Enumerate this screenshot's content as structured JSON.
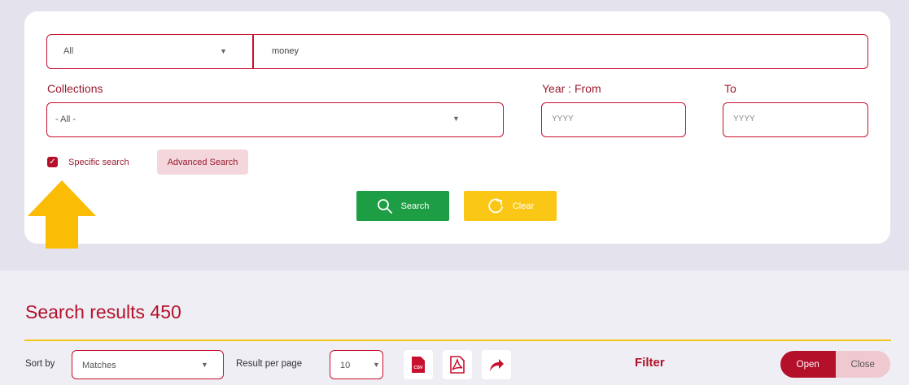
{
  "search": {
    "scope_select": "All",
    "query_value": "money",
    "collections_label": "Collections",
    "collections_select": "- All -",
    "year_from_label": "Year : From",
    "year_to_label": "To",
    "year_from_placeholder": "YYYY",
    "year_to_placeholder": "YYYY",
    "specific_search_label": "Specific search",
    "specific_search_checked": true,
    "advanced_search_label": "Advanced Search",
    "search_button_label": "Search",
    "clear_button_label": "Clear"
  },
  "results": {
    "title": "Search results 450",
    "sort_by_label": "Sort by",
    "sort_by_value": "Matches",
    "per_page_label": "Result per page",
    "per_page_value": "10",
    "export_icons": [
      "csv-icon",
      "pdf-icon",
      "share-icon"
    ],
    "csv_icon_text": "CSV",
    "filter_label": "Filter",
    "open_label": "Open",
    "close_label": "Close"
  },
  "colors": {
    "brand_red": "#c8102e",
    "dark_red": "#9a1b2e",
    "search_green": "#1e9e44",
    "clear_yellow": "#fbc716",
    "arrow_yellow": "#fbbc05",
    "page_bg": "#e4e3ed"
  }
}
